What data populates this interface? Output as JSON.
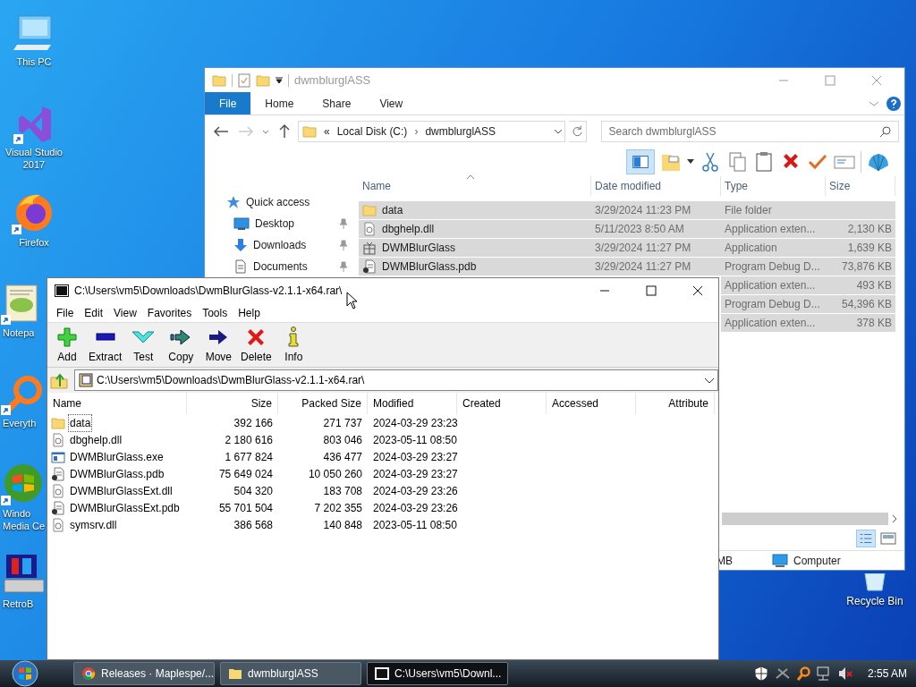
{
  "desktop": {
    "icons": [
      {
        "kind": "pc",
        "lines": [
          "This PC"
        ],
        "cut": false,
        "shortcut": false
      },
      {
        "kind": "vs",
        "lines": [
          "Visual Studio",
          "2017"
        ],
        "cut": false,
        "shortcut": true
      },
      {
        "kind": "firefox",
        "lines": [
          "Firefox"
        ],
        "cut": false,
        "shortcut": true
      },
      {
        "kind": "notepad",
        "lines": [
          "Notepa"
        ],
        "cut": true,
        "shortcut": true
      },
      {
        "kind": "search",
        "lines": [
          "Everyth"
        ],
        "cut": true,
        "shortcut": true
      },
      {
        "kind": "media",
        "lines": [
          "Windo",
          "Media Ce"
        ],
        "cut": true,
        "shortcut": true
      },
      {
        "kind": "retro",
        "lines": [
          "RetroB"
        ],
        "cut": true,
        "shortcut": false
      }
    ],
    "recycle_bin": {
      "label": "Recycle Bin"
    }
  },
  "explorer": {
    "title": "dwmblurglASS",
    "tabs": [
      {
        "label": "File",
        "selected": true
      },
      {
        "label": "Home",
        "selected": false
      },
      {
        "label": "Share",
        "selected": false
      },
      {
        "label": "View",
        "selected": false
      }
    ],
    "address": {
      "prefix": "«",
      "crumbs": [
        "Local Disk (C:)",
        "dwmblurglASS"
      ],
      "separator": "›"
    },
    "search": {
      "placeholder": "Search dwmblurglASS"
    },
    "sidebar": [
      {
        "kind": "star",
        "label": "Quick access",
        "pinned": false
      },
      {
        "kind": "desktop",
        "label": "Desktop",
        "pinned": true
      },
      {
        "kind": "download",
        "label": "Downloads",
        "pinned": true
      },
      {
        "kind": "document",
        "label": "Documents",
        "pinned": true
      }
    ],
    "columns": [
      "Name",
      "Date modified",
      "Type",
      "Size"
    ],
    "rows": [
      {
        "kind": "folder",
        "name": "data",
        "date": "3/29/2024 11:23 PM",
        "type": "File folder",
        "selected": true
      },
      {
        "kind": "dll",
        "name": "dbghelp.dll",
        "date": "5/11/2023 8:50 AM",
        "type": "Application exten...",
        "size": "2,130 KB",
        "selected": true
      },
      {
        "kind": "app",
        "name": "DWMBlurGlass",
        "date": "3/29/2024 11:27 PM",
        "type": "Application",
        "size": "1,639 KB",
        "selected": true
      },
      {
        "kind": "pdb",
        "name": "DWMBlurGlass.pdb",
        "date": "3/29/2024 11:27 PM",
        "type": "Program Debug D...",
        "size": "73,876 KB",
        "selected": true
      },
      {
        "type": "Application exten...",
        "size": "493 KB",
        "selected": true
      },
      {
        "type": "Program Debug D...",
        "size": "54,396 KB",
        "selected": true
      },
      {
        "type": "Application exten...",
        "size": "378 KB",
        "selected": true
      }
    ],
    "status": {
      "size": "MB",
      "location": "Computer"
    }
  },
  "sevenzip": {
    "title": "C:\\Users\\vm5\\Downloads\\DwmBlurGlass-v2.1.1-x64.rar\\",
    "menu": [
      "File",
      "Edit",
      "View",
      "Favorites",
      "Tools",
      "Help"
    ],
    "toolbar": [
      {
        "kind": "add",
        "label": "Add"
      },
      {
        "kind": "extract",
        "label": "Extract"
      },
      {
        "kind": "test",
        "label": "Test"
      },
      {
        "kind": "copy",
        "label": "Copy"
      },
      {
        "kind": "move",
        "label": "Move"
      },
      {
        "kind": "delete",
        "label": "Delete"
      },
      {
        "kind": "info",
        "label": "Info"
      }
    ],
    "path": "C:\\Users\\vm5\\Downloads\\DwmBlurGlass-v2.1.1-x64.rar\\",
    "columns": [
      "Name",
      "Size",
      "Packed Size",
      "Modified",
      "Created",
      "Accessed",
      "Attribute"
    ],
    "rows": [
      {
        "kind": "folder",
        "name": "data",
        "size": "392 166",
        "packed": "271 737",
        "modified": "2024-03-29 23:23",
        "focused": true
      },
      {
        "kind": "dll",
        "name": "dbghelp.dll",
        "size": "2 180 616",
        "packed": "803 046",
        "modified": "2023-05-11 08:50",
        "focused": false
      },
      {
        "kind": "exe",
        "name": "DWMBlurGlass.exe",
        "size": "1 677 824",
        "packed": "436 477",
        "modified": "2024-03-29 23:27",
        "focused": false
      },
      {
        "kind": "pdb",
        "name": "DWMBlurGlass.pdb",
        "size": "75 649 024",
        "packed": "10 050 260",
        "modified": "2024-03-29 23:27",
        "focused": false
      },
      {
        "kind": "dll",
        "name": "DWMBlurGlassExt.dll",
        "size": "504 320",
        "packed": "183 708",
        "modified": "2024-03-29 23:26",
        "focused": false
      },
      {
        "kind": "pdb",
        "name": "DWMBlurGlassExt.pdb",
        "size": "55 701 504",
        "packed": "7 202 355",
        "modified": "2024-03-29 23:26",
        "focused": false
      },
      {
        "kind": "dll",
        "name": "symsrv.dll",
        "size": "386 568",
        "packed": "140 848",
        "modified": "2023-05-11 08:50",
        "focused": false
      }
    ]
  },
  "taskbar": {
    "items": [
      {
        "kind": "chrome",
        "label": "Releases · Maplespe/...",
        "selected": false
      },
      {
        "kind": "folder",
        "label": "dwmblurglASS",
        "selected": false
      },
      {
        "kind": "sevenzip",
        "label": "C:\\Users\\vm5\\Downl...",
        "selected": true
      }
    ],
    "clock": "2:55 AM"
  }
}
